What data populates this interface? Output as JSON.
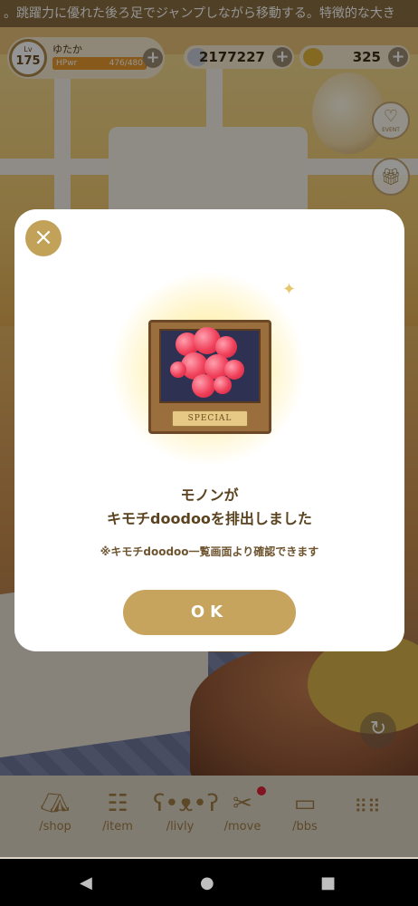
{
  "ticker": {
    "text": "。跳躍力に優れた後ろ足でジャンプしながら移動する。特徴的な大き"
  },
  "profile": {
    "lv_label": "Lv",
    "level": "175",
    "name": "ゆたか",
    "hp_label": "HPwr",
    "hp_value": "476/480",
    "hp_fraction": 0.99
  },
  "currencies": {
    "gems": "2177227",
    "coins": "325",
    "plus": "+"
  },
  "side_buttons": {
    "event_label": "EVENT"
  },
  "dialog": {
    "close": "×",
    "plate_text": "SPECIAL",
    "message_line1": "モノンが",
    "message_line2": "キモチdoodooを排出しました",
    "note": "※キモチdoodoo一覧画面より確認できます",
    "ok_label": "OK"
  },
  "nav": {
    "items": [
      {
        "label": "/shop",
        "icon": "tent-icon"
      },
      {
        "label": "/item",
        "icon": "cabinet-icon"
      },
      {
        "label": "/livly",
        "icon": "bear-icon"
      },
      {
        "label": "/move",
        "icon": "scissors-icon"
      },
      {
        "label": "/bbs",
        "icon": "board-icon"
      },
      {
        "label": "",
        "icon": "grid-menu-icon"
      }
    ]
  },
  "colors": {
    "accent": "#c7a45e",
    "text_brown": "#5b4320",
    "badge_red": "#e0243a"
  }
}
